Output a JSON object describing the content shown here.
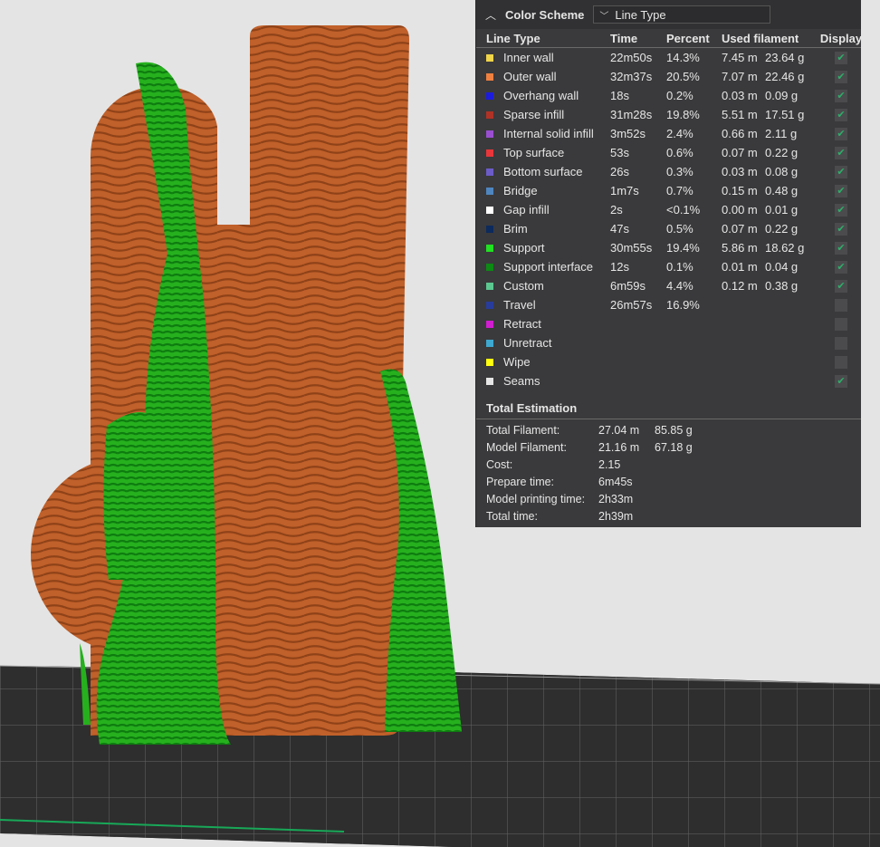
{
  "viewport": {
    "colors": {
      "background": "#e4e4e4",
      "bed": "#2e2e2e",
      "grid": "#6f6f6f",
      "model": "#c0602a",
      "model_stripe": "#8f4218",
      "support": "#26b01e",
      "support_dark": "#0e7c10"
    }
  },
  "panel": {
    "title": "Color Scheme",
    "scheme_value": "Line Type",
    "headers": {
      "line_type": "Line Type",
      "time": "Time",
      "percent": "Percent",
      "used_filament": "Used filament",
      "display": "Display"
    },
    "rows": [
      {
        "name": "Inner wall",
        "color": "#f0d44a",
        "time": "22m50s",
        "percent": "14.3%",
        "length": "7.45 m",
        "weight": "23.64 g",
        "display": true
      },
      {
        "name": "Outer wall",
        "color": "#f08040",
        "time": "32m37s",
        "percent": "20.5%",
        "length": "7.07 m",
        "weight": "22.46 g",
        "display": true
      },
      {
        "name": "Overhang wall",
        "color": "#1c1cdc",
        "time": "18s",
        "percent": "0.2%",
        "length": "0.03 m",
        "weight": "0.09 g",
        "display": true
      },
      {
        "name": "Sparse infill",
        "color": "#b03226",
        "time": "31m28s",
        "percent": "19.8%",
        "length": "5.51 m",
        "weight": "17.51 g",
        "display": true
      },
      {
        "name": "Internal solid infill",
        "color": "#9a4fd0",
        "time": "3m52s",
        "percent": "2.4%",
        "length": "0.66 m",
        "weight": "2.11 g",
        "display": true
      },
      {
        "name": "Top surface",
        "color": "#e8363a",
        "time": "53s",
        "percent": "0.6%",
        "length": "0.07 m",
        "weight": "0.22 g",
        "display": true
      },
      {
        "name": "Bottom surface",
        "color": "#6c5cc8",
        "time": "26s",
        "percent": "0.3%",
        "length": "0.03 m",
        "weight": "0.08 g",
        "display": true
      },
      {
        "name": "Bridge",
        "color": "#4f86c0",
        "time": "1m7s",
        "percent": "0.7%",
        "length": "0.15 m",
        "weight": "0.48 g",
        "display": true
      },
      {
        "name": "Gap infill",
        "color": "#ffffff",
        "time": "2s",
        "percent": "<0.1%",
        "length": "0.00 m",
        "weight": "0.01 g",
        "display": true
      },
      {
        "name": "Brim",
        "color": "#0c2a5c",
        "time": "47s",
        "percent": "0.5%",
        "length": "0.07 m",
        "weight": "0.22 g",
        "display": true
      },
      {
        "name": "Support",
        "color": "#22e022",
        "time": "30m55s",
        "percent": "19.4%",
        "length": "5.86 m",
        "weight": "18.62 g",
        "display": true
      },
      {
        "name": "Support interface",
        "color": "#0d8a14",
        "time": "12s",
        "percent": "0.1%",
        "length": "0.01 m",
        "weight": "0.04 g",
        "display": true
      },
      {
        "name": "Custom",
        "color": "#5cc890",
        "time": "6m59s",
        "percent": "4.4%",
        "length": "0.12 m",
        "weight": "0.38 g",
        "display": true
      },
      {
        "name": "Travel",
        "color": "#283c9c",
        "time": "26m57s",
        "percent": "16.9%",
        "length": "",
        "weight": "",
        "display": false
      },
      {
        "name": "Retract",
        "color": "#d01ed0",
        "time": "",
        "percent": "",
        "length": "",
        "weight": "",
        "display": false
      },
      {
        "name": "Unretract",
        "color": "#3ea8d0",
        "time": "",
        "percent": "",
        "length": "",
        "weight": "",
        "display": false
      },
      {
        "name": "Wipe",
        "color": "#ffff10",
        "time": "",
        "percent": "",
        "length": "",
        "weight": "",
        "display": false
      },
      {
        "name": "Seams",
        "color": "#e6e6e6",
        "time": "",
        "percent": "",
        "length": "",
        "weight": "",
        "display": true
      }
    ],
    "totals": {
      "title": "Total Estimation",
      "rows": [
        {
          "label": "Total Filament:",
          "v1": "27.04 m",
          "v2": "85.85 g"
        },
        {
          "label": "Model Filament:",
          "v1": "21.16 m",
          "v2": "67.18 g"
        },
        {
          "label": "Cost:",
          "v1": "2.15",
          "v2": ""
        },
        {
          "label": "Prepare time:",
          "v1": "6m45s",
          "v2": ""
        },
        {
          "label": "Model printing time:",
          "v1": "2h33m",
          "v2": ""
        },
        {
          "label": "Total time:",
          "v1": "2h39m",
          "v2": ""
        }
      ]
    }
  }
}
